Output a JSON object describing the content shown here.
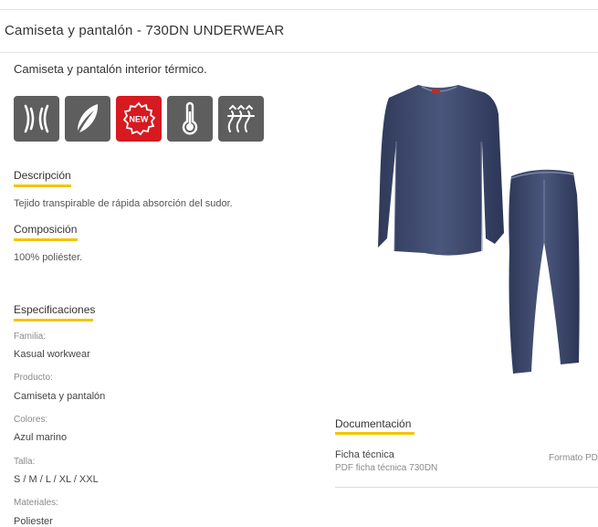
{
  "header": {
    "title": "Camiseta y pantalón - 730DN UNDERWEAR"
  },
  "product": {
    "subtitle": "Camiseta y pantalón interior térmico.",
    "feature_icons": [
      "breathable-icon",
      "lightweight-feather-icon",
      "new-badge-icon",
      "thermal-thermometer-icon",
      "heat-dissipation-icon"
    ],
    "new_badge_text": "NEW"
  },
  "description": {
    "title": "Descripción",
    "text": "Tejido transpirable de rápida absorción del sudor."
  },
  "composition": {
    "title": "Composición",
    "text": "100% poliéster."
  },
  "specs": {
    "title": "Especificaciones",
    "items": [
      {
        "label": "Familia:",
        "value": "Kasual workwear"
      },
      {
        "label": "Producto:",
        "value": "Camiseta y pantalón"
      },
      {
        "label": "Colores:",
        "value": "Azul marino"
      },
      {
        "label": "Talla:",
        "value": "S / M / L / XL / XXL"
      },
      {
        "label": "Materiales:",
        "value": "Poliester"
      }
    ]
  },
  "documentation": {
    "title": "Documentación",
    "items": [
      {
        "name": "Ficha técnica",
        "subtitle": "PDF ficha técnica 730DN",
        "format": "Formato PDF"
      }
    ]
  },
  "colors": {
    "accent_underline": "#f2c500",
    "icon_bg": "#5e5e5e",
    "new_bg": "#d71920",
    "garment": "#3e4a6e"
  }
}
